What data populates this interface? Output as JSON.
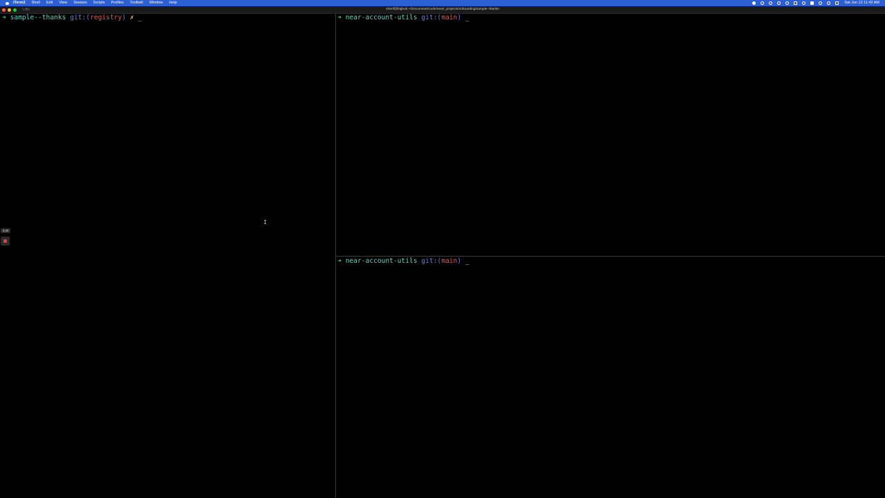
{
  "menubar": {
    "app_name": "iTerm2",
    "menus": [
      "Shell",
      "Edit",
      "View",
      "Session",
      "Scripts",
      "Profiles",
      "Toolbelt",
      "Window",
      "Help"
    ],
    "clock": "Sat Jun 12  11:42 AM"
  },
  "titlebar": {
    "shortcut": "⌥⌘1",
    "title": "sherif@bigbuk:~/Documents/code/near/_projects/onboarding/sample--thanks"
  },
  "panes": {
    "left": {
      "arrow": "➜",
      "dir": "sample--thanks",
      "git_label": "git:(",
      "branch": "registry",
      "git_close": ")",
      "dirty": "✗",
      "cursor": "_"
    },
    "right_top": {
      "arrow": "➜",
      "dir": "near-account-utils",
      "git_label": "git:(",
      "branch": "main",
      "git_close": ")",
      "cursor": "_"
    },
    "right_bottom": {
      "arrow": "➜",
      "dir": "near-account-utils",
      "git_label": "git:(",
      "branch": "main",
      "git_close": ")",
      "cursor": "_"
    }
  },
  "recording": {
    "timer": "0:00"
  },
  "colors": {
    "menubar": "#2d5fd4",
    "arrow": "#4fd16a",
    "dir": "#5fd7c6",
    "git_label": "#6b7cf0",
    "branch": "#e2585e",
    "dirty": "#f0c05a"
  },
  "icons": {
    "pointer": "i-beam-cursor-icon",
    "record_stop": "stop-recording-icon"
  }
}
